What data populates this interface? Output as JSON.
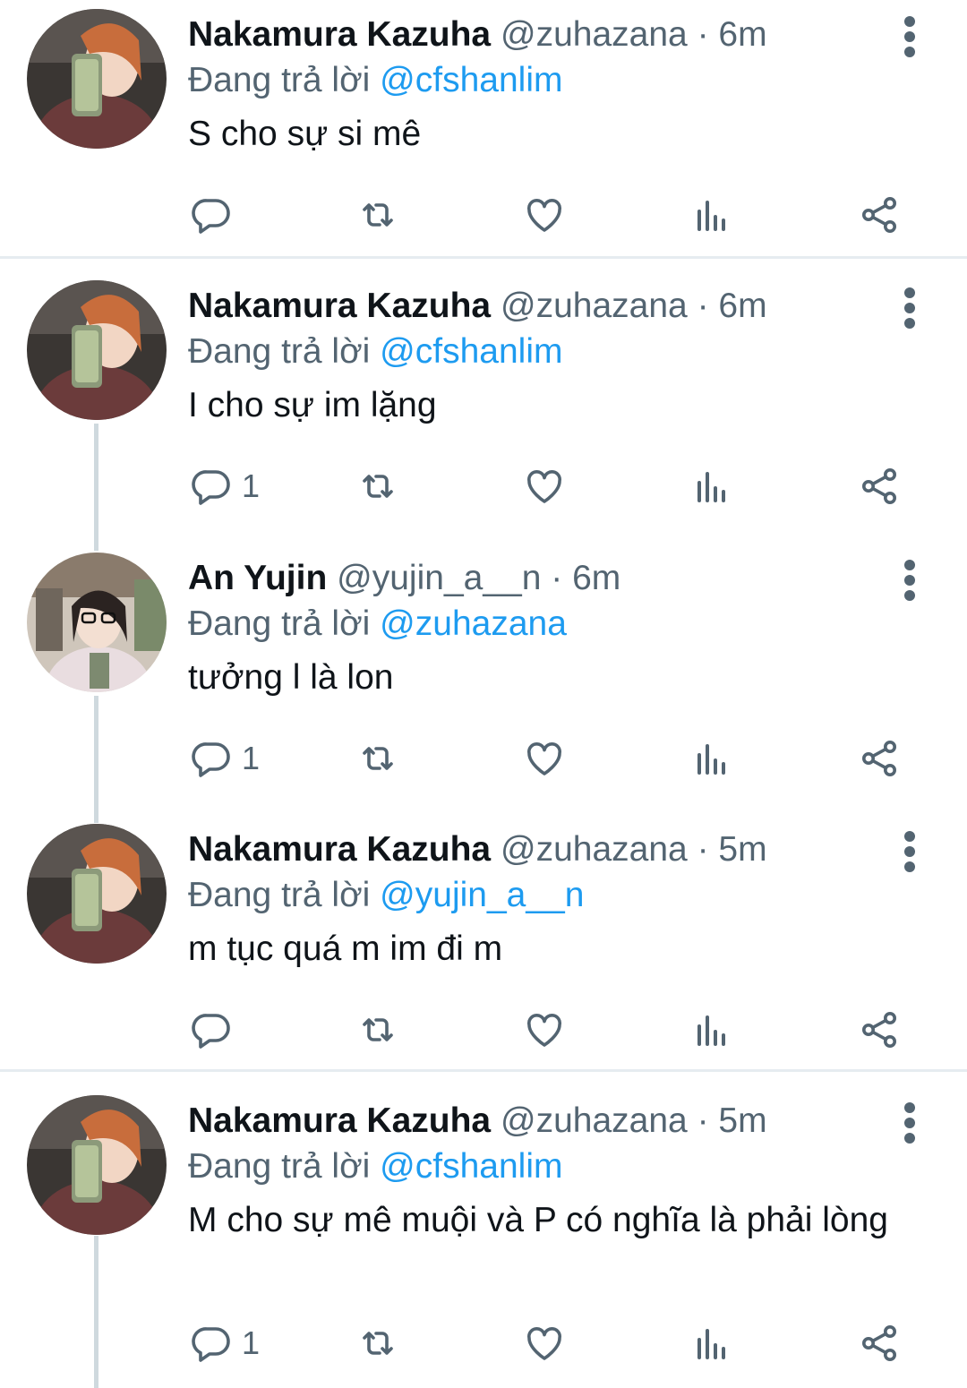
{
  "colors": {
    "name": "#0f1419",
    "muted": "#536471",
    "link": "#1d9bf0",
    "thread_line": "#cfd9de",
    "divider": "#e6ecf0"
  },
  "icons": [
    "reply-icon",
    "retweet-icon",
    "like-icon",
    "views-icon",
    "share-icon",
    "more-icon"
  ],
  "tweets": [
    {
      "name": "Nakamura Kazuha",
      "handle": "@zuhazana",
      "sep": "·",
      "time": "6m",
      "reply_prefix": "Đang trả lời",
      "reply_to": "@cfshanlim",
      "text": "S cho sự si mê",
      "reply_count": ""
    },
    {
      "name": "Nakamura Kazuha",
      "handle": "@zuhazana",
      "sep": "·",
      "time": "6m",
      "reply_prefix": "Đang trả lời",
      "reply_to": "@cfshanlim",
      "text": "I cho sự im lặng",
      "reply_count": "1"
    },
    {
      "name": "An Yujin",
      "handle": "@yujin_a__n",
      "sep": "·",
      "time": "6m",
      "reply_prefix": "Đang trả lời",
      "reply_to": "@zuhazana",
      "text": "tưởng l là lon",
      "reply_count": "1"
    },
    {
      "name": "Nakamura Kazuha",
      "handle": "@zuhazana",
      "sep": "·",
      "time": "5m",
      "reply_prefix": "Đang trả lời",
      "reply_to": "@yujin_a__n",
      "text": "m tục quá m im đi m",
      "reply_count": ""
    },
    {
      "name": "Nakamura Kazuha",
      "handle": "@zuhazana",
      "sep": "·",
      "time": "5m",
      "reply_prefix": "Đang trả lời",
      "reply_to": "@cfshanlim",
      "text": "M cho sự mê muội và P có nghĩa là phải lòng",
      "reply_count": "1"
    }
  ]
}
